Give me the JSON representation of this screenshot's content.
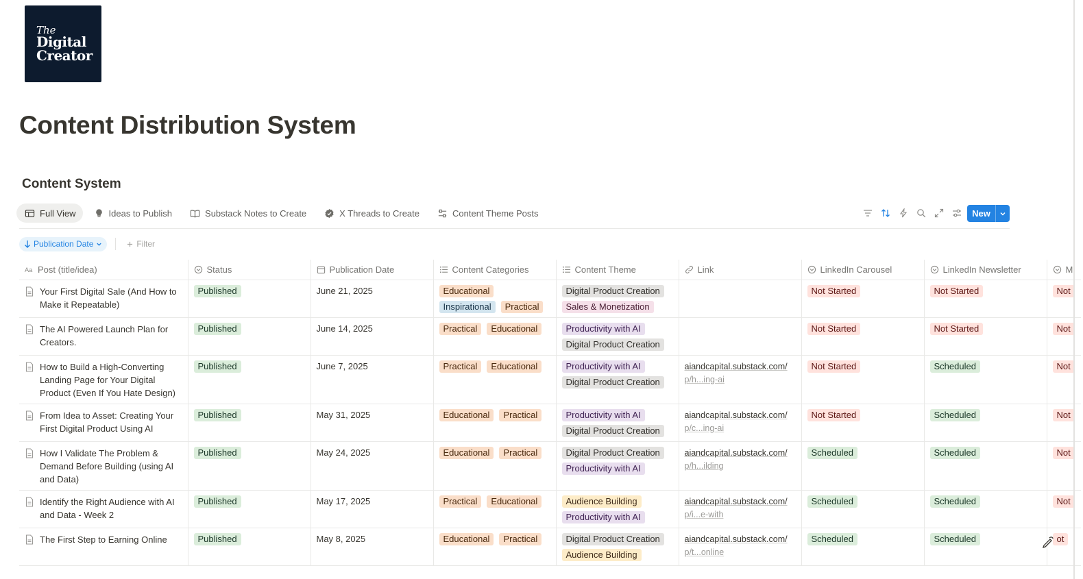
{
  "logo": {
    "line1": "The",
    "line2": "Digital",
    "line3": "Creator"
  },
  "page_title": "Content Distribution System",
  "section_title": "Content System",
  "tabs": [
    {
      "label": "Full View",
      "icon": "table-icon",
      "active": true
    },
    {
      "label": "Ideas to Publish",
      "icon": "lightbulb-icon",
      "active": false
    },
    {
      "label": "Substack Notes to Create",
      "icon": "open-book-icon",
      "active": false
    },
    {
      "label": "X Threads to Create",
      "icon": "verified-badge-icon",
      "active": false
    },
    {
      "label": "Content Theme Posts",
      "icon": "sliders-icon",
      "active": false
    }
  ],
  "toolbar": {
    "new_label": "New"
  },
  "sort": {
    "label": "Publication Date"
  },
  "filter": {
    "label": "Filter"
  },
  "columns": [
    {
      "label": "Post (title/idea)",
      "icon": "text-type-icon"
    },
    {
      "label": "Status",
      "icon": "status-icon"
    },
    {
      "label": "Publication Date",
      "icon": "calendar-icon"
    },
    {
      "label": "Content Categories",
      "icon": "list-icon"
    },
    {
      "label": "Content Theme",
      "icon": "list-icon"
    },
    {
      "label": "Link",
      "icon": "link-icon"
    },
    {
      "label": "LinkedIn Carousel",
      "icon": "status-icon"
    },
    {
      "label": "LinkedIn Newsletter",
      "icon": "status-icon"
    },
    {
      "label": "M",
      "icon": "status-icon"
    }
  ],
  "colors": {
    "green_bg": "#dbeddb",
    "green_fg": "#1c3829",
    "red_bg": "#ffe2dd",
    "red_fg": "#5d1715",
    "orange_bg": "#fadec9",
    "orange_fg": "#49290e",
    "blue_bg": "#d3e5ef",
    "blue_fg": "#183347",
    "gray_bg": "#e3e2e0",
    "gray_fg": "#32302c",
    "purple_bg": "#e8deee",
    "purple_fg": "#412454",
    "pink_bg": "#f5e0e9",
    "pink_fg": "#4c2337",
    "yellow_bg": "#fdecc8",
    "yellow_fg": "#402c1b",
    "accent": "#2383e2"
  },
  "rows": [
    {
      "title": "Your First Digital Sale (And How to Make it Repeatable)",
      "status": "Published",
      "date": "June 21, 2025",
      "categories": [
        "Educational",
        "Inspirational",
        "Practical"
      ],
      "themes": [
        "Digital Product Creation",
        "Sales & Monetization"
      ],
      "link1": "",
      "link2": "",
      "carousel": "Not Started",
      "newsletter": "Not Started",
      "extra": "Not"
    },
    {
      "title": "The AI Powered Launch Plan for Creators.",
      "status": "Published",
      "date": "June 14, 2025",
      "categories": [
        "Practical",
        "Educational"
      ],
      "themes": [
        "Productivity with AI",
        "Digital Product Creation"
      ],
      "link1": "",
      "link2": "",
      "carousel": "Not Started",
      "newsletter": "Not Started",
      "extra": "Not"
    },
    {
      "title": "How to Build a High-Converting Landing Page for Your Digital Product (Even If You Hate Design)",
      "status": "Published",
      "date": "June 7, 2025",
      "categories": [
        "Practical",
        "Educational"
      ],
      "themes": [
        "Productivity with AI",
        "Digital Product Creation"
      ],
      "link1": "aiandcapital.substack.com/",
      "link2": "p/h...ing-ai",
      "carousel": "Not Started",
      "newsletter": "Scheduled",
      "extra": "Not"
    },
    {
      "title": "From Idea to Asset: Creating Your First Digital Product Using AI",
      "status": "Published",
      "date": "May 31, 2025",
      "categories": [
        "Educational",
        "Practical"
      ],
      "themes": [
        "Productivity with AI",
        "Digital Product Creation"
      ],
      "link1": "aiandcapital.substack.com/",
      "link2": "p/c...ing-ai",
      "carousel": "Not Started",
      "newsletter": "Scheduled",
      "extra": "Not"
    },
    {
      "title": "How I Validate The Problem & Demand Before Building (using AI and Data)",
      "status": "Published",
      "date": "May 24, 2025",
      "categories": [
        "Educational",
        "Practical"
      ],
      "themes": [
        "Digital Product Creation",
        "Productivity with AI"
      ],
      "link1": "aiandcapital.substack.com/",
      "link2": "p/h...ilding",
      "carousel": "Scheduled",
      "newsletter": "Scheduled",
      "extra": "Not"
    },
    {
      "title": "Identify the Right Audience with AI and Data - Week 2",
      "status": "Published",
      "date": "May 17, 2025",
      "categories": [
        "Practical",
        "Educational"
      ],
      "themes": [
        "Audience Building",
        "Productivity with AI"
      ],
      "link1": "aiandcapital.substack.com/",
      "link2": "p/i...e-with",
      "carousel": "Scheduled",
      "newsletter": "Scheduled",
      "extra": "Not"
    },
    {
      "title": "The First Step to Earning Online",
      "status": "Published",
      "date": "May 8, 2025",
      "categories": [
        "Educational",
        "Practical"
      ],
      "themes": [
        "Digital Product Creation",
        "Audience Building"
      ],
      "link1": "aiandcapital.substack.com/",
      "link2": "p/t...online",
      "carousel": "Scheduled",
      "newsletter": "Scheduled",
      "extra": "ot"
    }
  ]
}
